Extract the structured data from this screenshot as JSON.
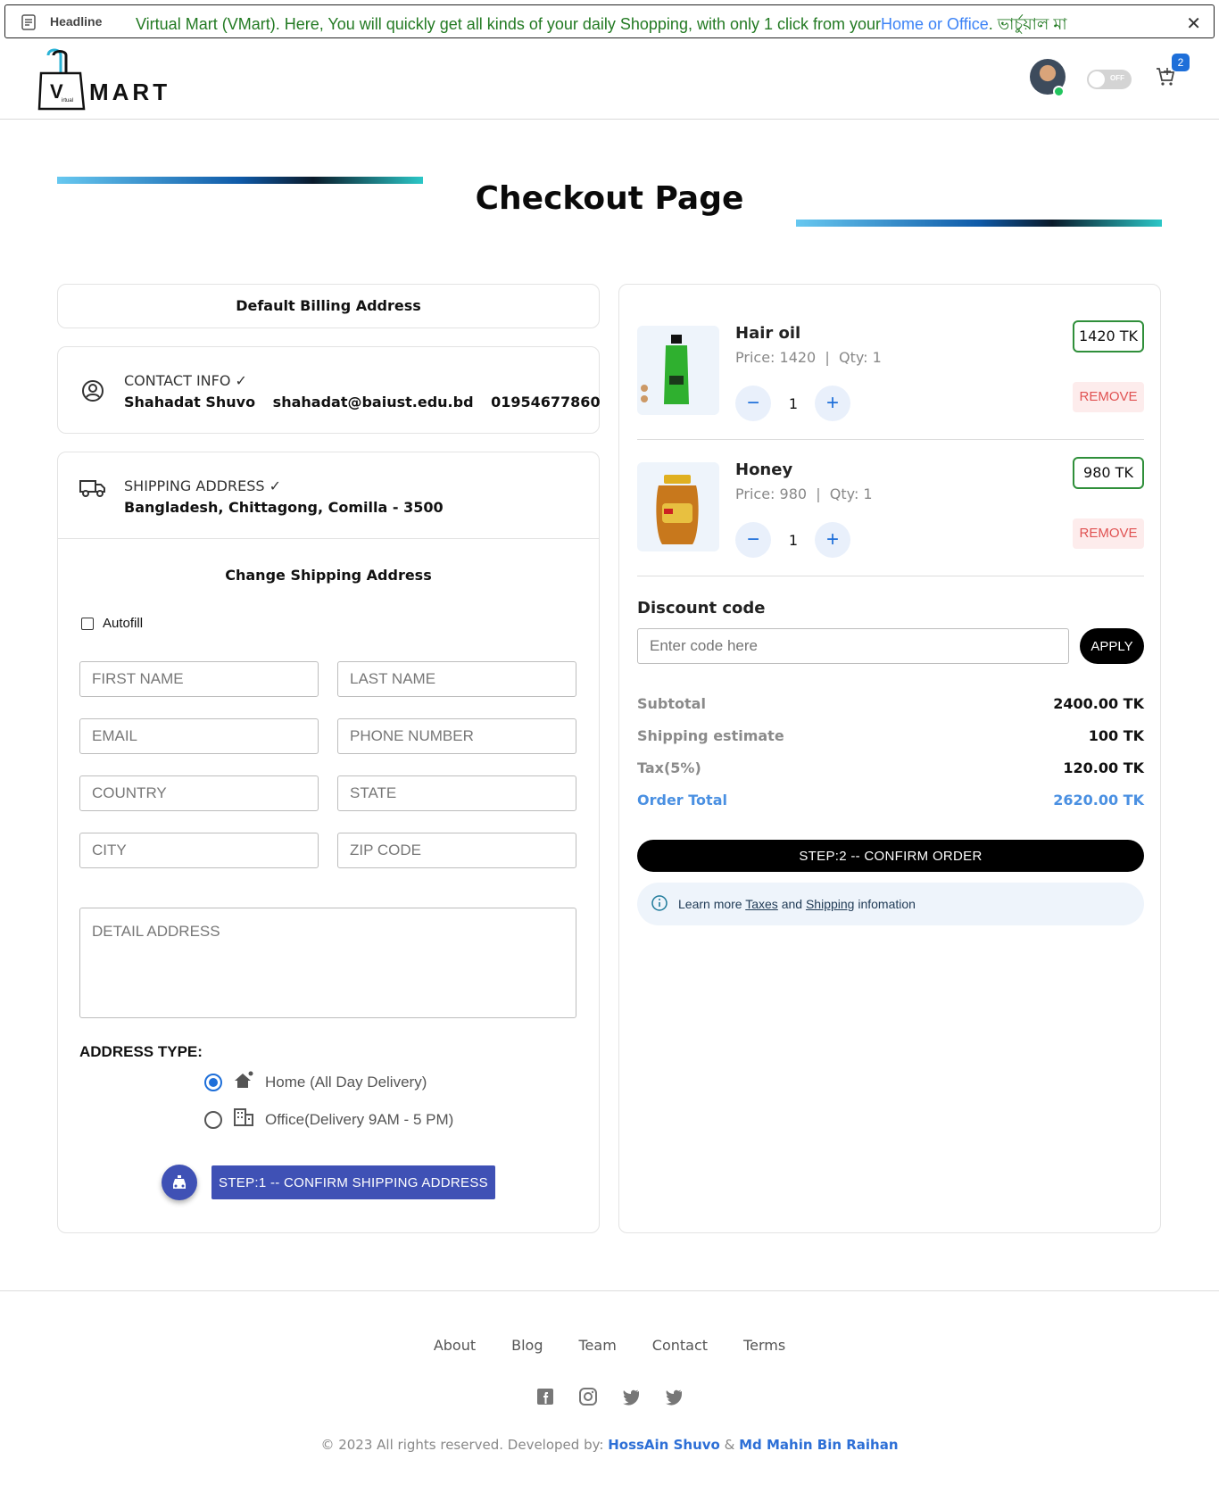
{
  "headline": {
    "label": "Headline",
    "text": "Virtual Mart (VMart). Here, You will quickly get all kinds of your daily Shopping, with only 1 click from your",
    "link": "Home or Office",
    "tail": ". ভার্চুয়াল মা",
    "close_icon": "close-icon"
  },
  "header": {
    "logo_text": "MART",
    "toggle_label": "OFF",
    "cart_count": "2"
  },
  "page_title": "Checkout Page",
  "billing": {
    "title": "Default Billing Address"
  },
  "contact": {
    "label": "CONTACT INFO",
    "name": "Shahadat Shuvo",
    "email": "shahadat@baiust.edu.bd",
    "phone": "01954677860"
  },
  "shipping": {
    "label": "SHIPPING ADDRESS",
    "address": "Bangladesh, Chittagong, Comilla - 3500",
    "change_title": "Change Shipping Address",
    "autofill_label": "Autofill",
    "placeholders": {
      "first_name": "FIRST NAME",
      "last_name": "LAST NAME",
      "email": "EMAIL",
      "phone": "PHONE NUMBER",
      "country": "COUNTRY",
      "state": "STATE",
      "city": "CITY",
      "zip": "ZIP CODE",
      "detail": "DETAIL ADDRESS"
    },
    "address_type_label": "ADDRESS TYPE:",
    "options": [
      {
        "label": "Home (All Day Delivery)",
        "selected": true
      },
      {
        "label": "Office(Delivery 9AM - 5 PM)",
        "selected": false
      }
    ],
    "confirm_label": "STEP:1 -- CONFIRM SHIPPING ADDRESS"
  },
  "order": {
    "items": [
      {
        "name": "Hair oil",
        "price_text": "Price: 1420",
        "qty_text": "Qty: 1",
        "qty": "1",
        "total": "1420 TK",
        "remove": "REMOVE"
      },
      {
        "name": "Honey",
        "price_text": "Price: 980",
        "qty_text": "Qty: 1",
        "qty": "1",
        "total": "980 TK",
        "remove": "REMOVE"
      }
    ],
    "discount": {
      "label": "Discount code",
      "placeholder": "Enter code here",
      "apply": "APPLY"
    },
    "summary": {
      "subtotal_label": "Subtotal",
      "subtotal": "2400.00 TK",
      "shipping_label": "Shipping estimate",
      "shipping": "100 TK",
      "tax_label": "Tax(5%)",
      "tax": "120.00 TK",
      "total_label": "Order Total",
      "total": "2620.00 TK"
    },
    "confirm_label": "STEP:2 -- CONFIRM ORDER",
    "info": {
      "prefix": "Learn more",
      "taxes": "Taxes",
      "and": "and",
      "shipping": "Shipping",
      "suffix": "infomation"
    }
  },
  "footer": {
    "nav": [
      "About",
      "Blog",
      "Team",
      "Contact",
      "Terms"
    ],
    "copyright": "© 2023 All rights reserved.  Developed by:",
    "dev1": "HossAin Shuvo",
    "amp": "&",
    "dev2": "Md Mahin Bin Raihan"
  },
  "colors": {
    "accent": "#3f51b5",
    "link": "#4a90e2",
    "price_border": "#2f8f3a",
    "remove": "#e05252"
  }
}
